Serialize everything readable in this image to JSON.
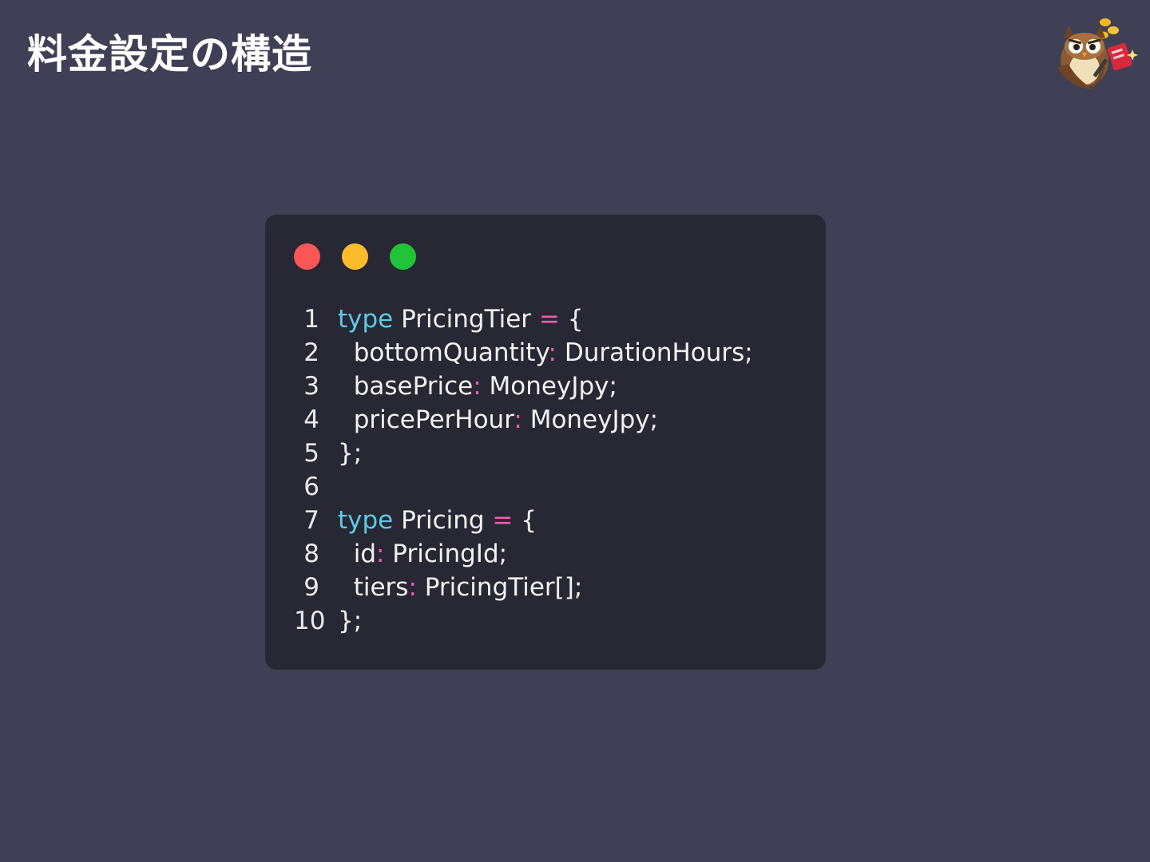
{
  "slide": {
    "title": "料金設定の構造"
  },
  "mascot": {
    "icon": "owl-mascot-icon"
  },
  "colors": {
    "background": "#3f4055",
    "code_bg": "#272833",
    "keyword": "#5ec9e6",
    "operator": "#ec5fa9",
    "text": "#f1f1f4",
    "dot_red": "#fb5656",
    "dot_yellow": "#fcbb2a",
    "dot_green": "#1fc537"
  },
  "code": {
    "lines": [
      {
        "num": "1",
        "parts": [
          {
            "t": "type",
            "k": "kw"
          },
          {
            "t": " PricingTier "
          },
          {
            "t": "=",
            "k": "op"
          },
          {
            "t": " {"
          }
        ]
      },
      {
        "num": "2",
        "parts": [
          {
            "t": "  bottomQuantity"
          },
          {
            "t": ":",
            "k": "op"
          },
          {
            "t": " DurationHours;"
          }
        ]
      },
      {
        "num": "3",
        "parts": [
          {
            "t": "  basePrice"
          },
          {
            "t": ":",
            "k": "op"
          },
          {
            "t": " MoneyJpy;"
          }
        ]
      },
      {
        "num": "4",
        "parts": [
          {
            "t": "  pricePerHour"
          },
          {
            "t": ":",
            "k": "op"
          },
          {
            "t": " MoneyJpy;"
          }
        ]
      },
      {
        "num": "5",
        "parts": [
          {
            "t": "};"
          }
        ]
      },
      {
        "num": "6",
        "parts": []
      },
      {
        "num": "7",
        "parts": [
          {
            "t": "type",
            "k": "kw"
          },
          {
            "t": " Pricing "
          },
          {
            "t": "=",
            "k": "op"
          },
          {
            "t": " {"
          }
        ]
      },
      {
        "num": "8",
        "parts": [
          {
            "t": "  id"
          },
          {
            "t": ":",
            "k": "op"
          },
          {
            "t": " PricingId;"
          }
        ]
      },
      {
        "num": "9",
        "parts": [
          {
            "t": "  tiers"
          },
          {
            "t": ":",
            "k": "op"
          },
          {
            "t": " PricingTier[];"
          }
        ]
      },
      {
        "num": "10",
        "parts": [
          {
            "t": "};"
          }
        ]
      }
    ]
  }
}
